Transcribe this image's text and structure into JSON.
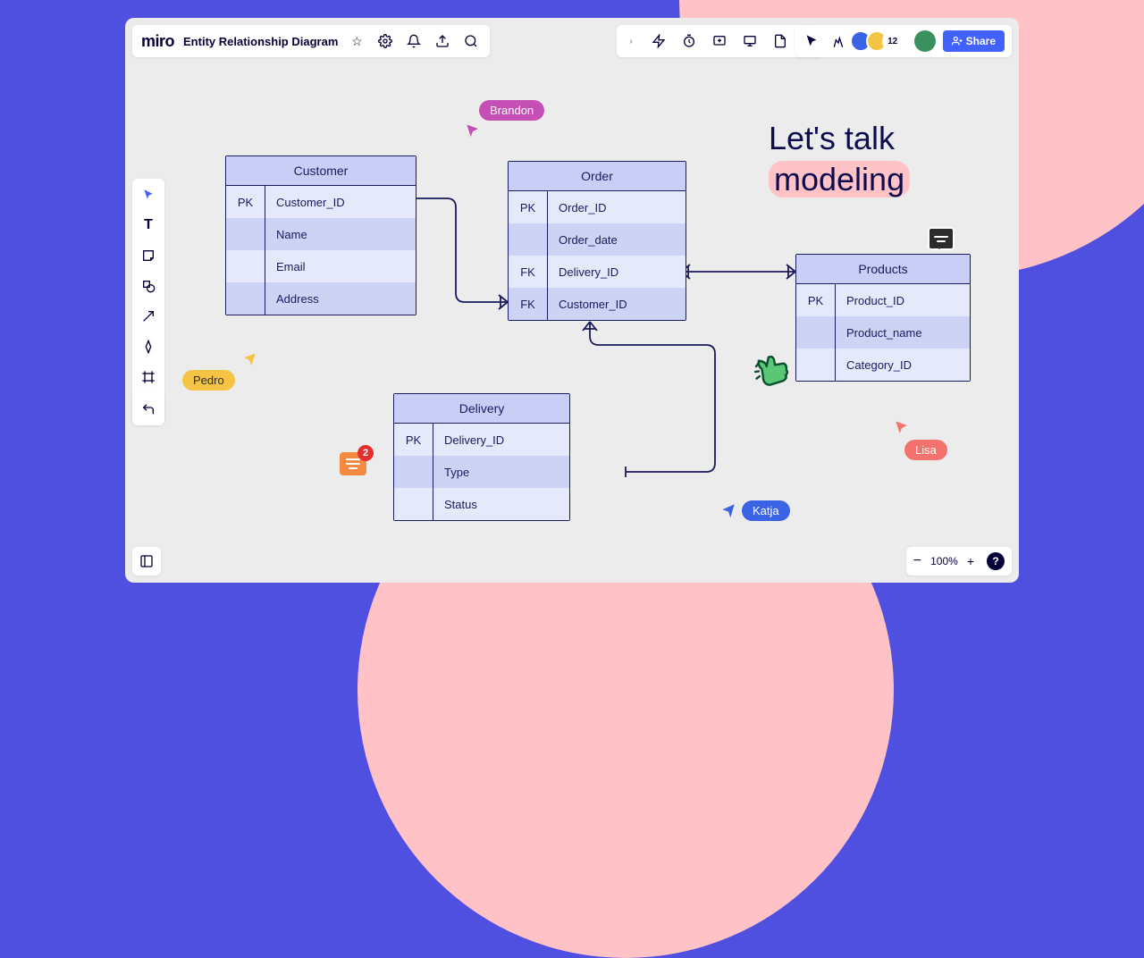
{
  "app": {
    "logo": "miro",
    "board_title": "Entity Relationship Diagram"
  },
  "toolbar_right": {
    "avatar_count": "12",
    "share_label": "Share"
  },
  "zoom": {
    "level": "100%",
    "minus": "−",
    "plus": "+",
    "help": "?"
  },
  "heading": {
    "line1": "Let's talk",
    "line2": "modeling"
  },
  "comment": {
    "badge": "2"
  },
  "cursors": {
    "brandon": {
      "name": "Brandon",
      "color": "#C64FB5"
    },
    "pedro": {
      "name": "Pedro",
      "color": "#F6C445"
    },
    "katja": {
      "name": "Katja",
      "color": "#3B63E5"
    },
    "lisa": {
      "name": "Lisa",
      "color": "#F4726E"
    }
  },
  "entities": {
    "customer": {
      "title": "Customer",
      "rows": [
        {
          "key": "PK",
          "attr": "Customer_ID"
        },
        {
          "key": "",
          "attr": "Name"
        },
        {
          "key": "",
          "attr": "Email"
        },
        {
          "key": "",
          "attr": "Address"
        }
      ]
    },
    "order": {
      "title": "Order",
      "rows": [
        {
          "key": "PK",
          "attr": "Order_ID"
        },
        {
          "key": "",
          "attr": "Order_date"
        },
        {
          "key": "FK",
          "attr": "Delivery_ID"
        },
        {
          "key": "FK",
          "attr": "Customer_ID"
        }
      ]
    },
    "delivery": {
      "title": "Delivery",
      "rows": [
        {
          "key": "PK",
          "attr": "Delivery_ID"
        },
        {
          "key": "",
          "attr": "Type"
        },
        {
          "key": "",
          "attr": "Status"
        }
      ]
    },
    "products": {
      "title": "Products",
      "rows": [
        {
          "key": "PK",
          "attr": "Product_ID"
        },
        {
          "key": "",
          "attr": "Product_name"
        },
        {
          "key": "",
          "attr": "Category_ID"
        }
      ]
    }
  }
}
